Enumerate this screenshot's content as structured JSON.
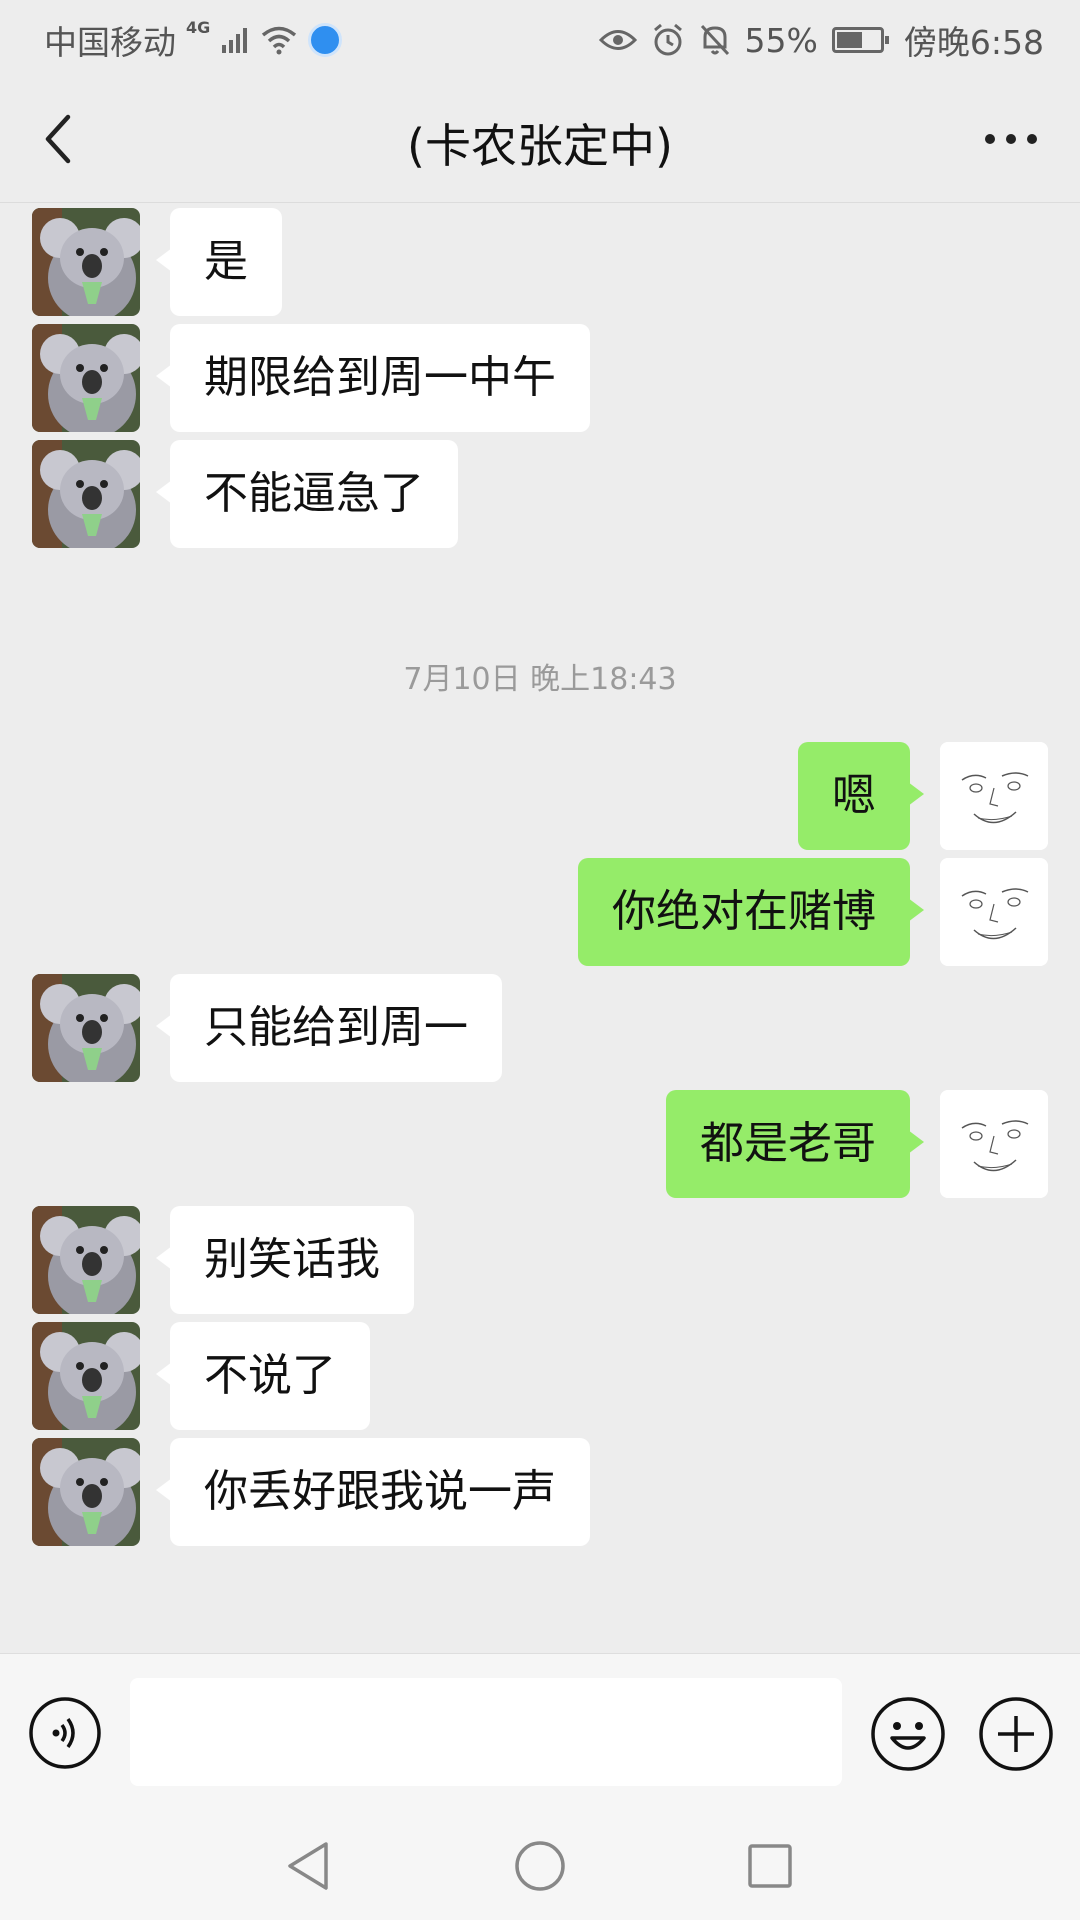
{
  "status_bar": {
    "carrier": "中国移动",
    "network": "4G",
    "battery": "55%",
    "time": "傍晚6:58"
  },
  "header": {
    "title": "(卡农张定中)"
  },
  "timestamp": "7月10日 晚上18:43",
  "messages": [
    {
      "side": "left",
      "text": "是"
    },
    {
      "side": "left",
      "text": "期限给到周一中午"
    },
    {
      "side": "left",
      "text": "不能逼急了"
    },
    {
      "side": "right",
      "text": "嗯"
    },
    {
      "side": "right",
      "text": "你绝对在赌博"
    },
    {
      "side": "left",
      "text": "只能给到周一"
    },
    {
      "side": "right",
      "text": "都是老哥"
    },
    {
      "side": "left",
      "text": "别笑话我"
    },
    {
      "side": "left",
      "text": "不说了"
    },
    {
      "side": "left",
      "text": "你丢好跟我说一声"
    }
  ],
  "input": {
    "value": "",
    "placeholder": ""
  },
  "colors": {
    "background": "#ededed",
    "bubble_self": "#95ec69",
    "bubble_other": "#ffffff"
  },
  "icons": {
    "back": "back-arrow-icon",
    "more": "more-dots-icon",
    "voice": "voice-icon",
    "emoji": "emoji-icon",
    "plus": "plus-icon"
  }
}
